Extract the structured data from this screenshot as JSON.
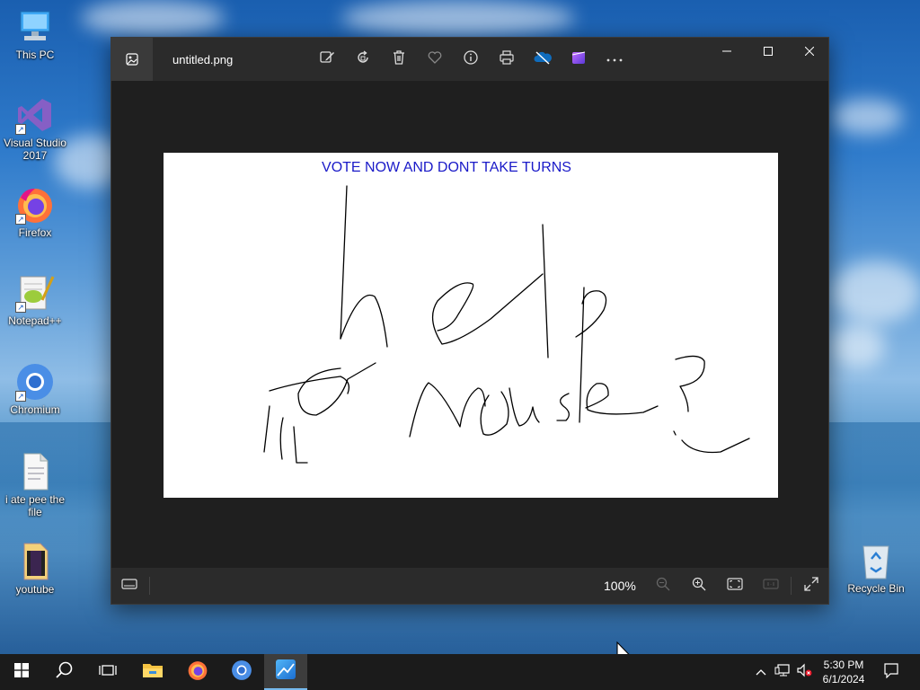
{
  "desktop": {
    "icons": [
      {
        "label": "This PC"
      },
      {
        "label": "Visual Studio 2017"
      },
      {
        "label": "Firefox"
      },
      {
        "label": "Notepad++"
      },
      {
        "label": "Chromium"
      },
      {
        "label": "i ate pee the file"
      },
      {
        "label": "youtube"
      },
      {
        "label": "Recycle Bin"
      }
    ]
  },
  "photos": {
    "title": "untitled.png",
    "image_caption": "VOTE NOW AND DONT TAKE TURNS",
    "toolbar_icons": [
      "edit-icon",
      "rotate-icon",
      "delete-icon",
      "favorite-icon",
      "info-icon",
      "print-icon",
      "onedrive-icon",
      "clipchamp-icon",
      "more-icon"
    ],
    "zoom": "100%"
  },
  "taskbar": {
    "clock_time": "5:30 PM",
    "clock_date": "6/1/2024",
    "accent": "#76b9ed"
  }
}
